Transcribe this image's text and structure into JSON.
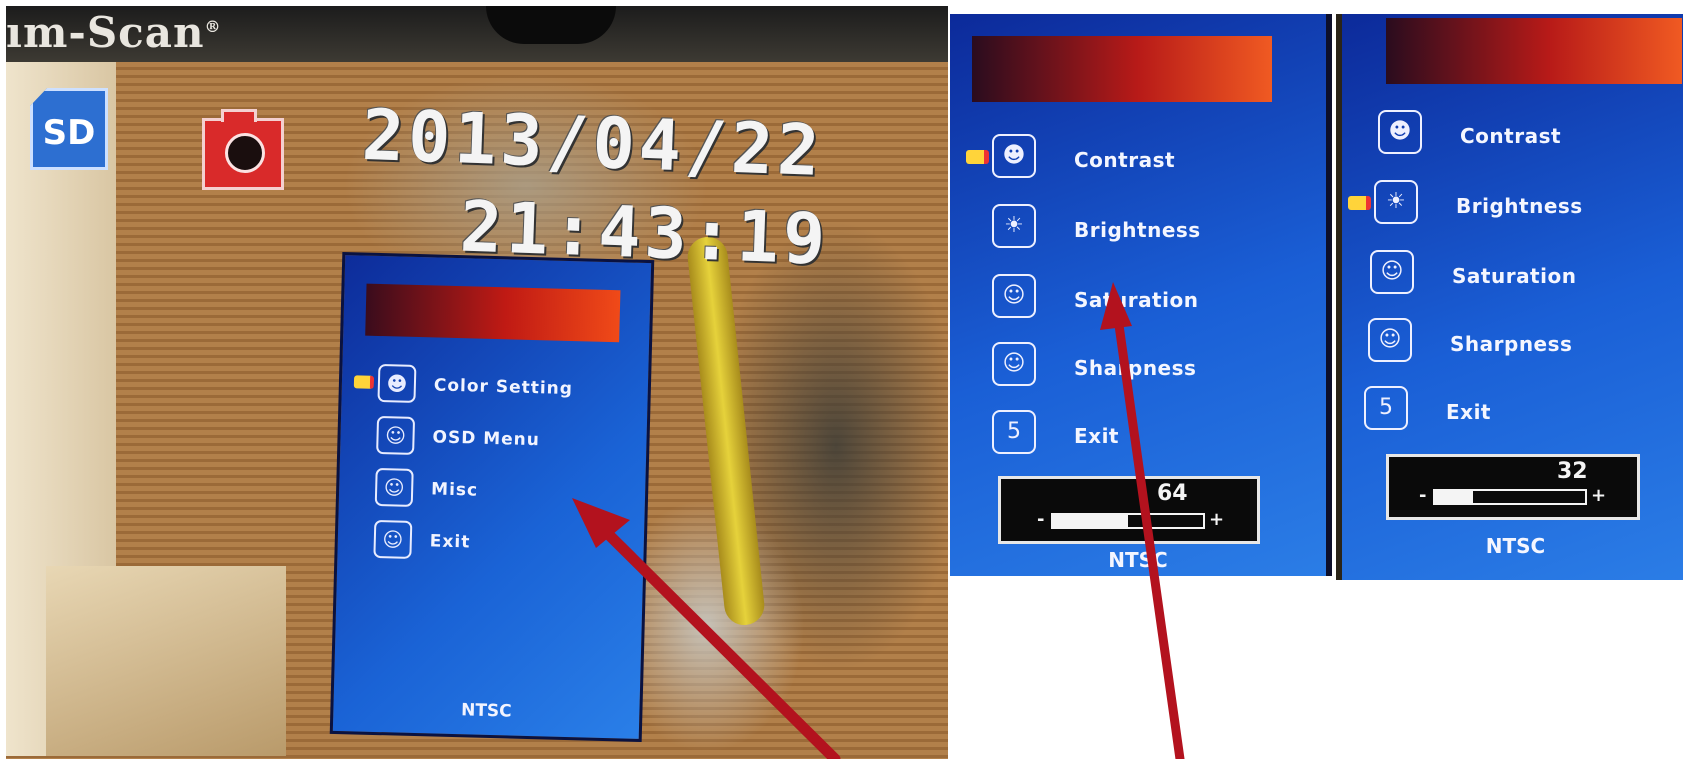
{
  "camera_view": {
    "brand": "ım-Scan",
    "brand_mark": "®",
    "storage_badge": "SD",
    "date": "2013/04/22",
    "time": "21:43:19"
  },
  "main_menu": {
    "items": [
      {
        "label": "Color Setting",
        "icon": "color-setting-icon",
        "selected": true
      },
      {
        "label": "OSD Menu",
        "icon": "osd-menu-icon",
        "selected": false
      },
      {
        "label": "Misc",
        "icon": "misc-icon",
        "selected": false
      },
      {
        "label": "Exit",
        "icon": "exit-icon",
        "selected": false
      }
    ],
    "footer": "NTSC"
  },
  "color_menu_contrast": {
    "items": [
      {
        "label": "Contrast",
        "icon": "contrast-icon",
        "selected": true
      },
      {
        "label": "Brightness",
        "icon": "brightness-icon",
        "selected": false
      },
      {
        "label": "Saturation",
        "icon": "saturation-icon",
        "selected": false
      },
      {
        "label": "Sharpness",
        "icon": "sharpness-icon",
        "selected": false
      },
      {
        "label": "Exit",
        "icon": "exit-icon",
        "selected": false
      }
    ],
    "level": "64",
    "level_fraction": 0.5,
    "footer": "NTSC"
  },
  "color_menu_brightness": {
    "items": [
      {
        "label": "Contrast",
        "icon": "contrast-icon",
        "selected": false
      },
      {
        "label": "Brightness",
        "icon": "brightness-icon",
        "selected": true
      },
      {
        "label": "Saturation",
        "icon": "saturation-icon",
        "selected": false
      },
      {
        "label": "Sharpness",
        "icon": "sharpness-icon",
        "selected": false
      },
      {
        "label": "Exit",
        "icon": "exit-icon",
        "selected": false
      }
    ],
    "level": "32",
    "level_fraction": 0.25,
    "footer": "NTSC"
  },
  "level_controls": {
    "minus": "-",
    "plus": "+"
  },
  "colors": {
    "osd_blue": "#1a5fd6",
    "title_red": "#c01a14",
    "annotation_arrow": "#b3121e",
    "pointer_yellow": "#ffd43a"
  }
}
